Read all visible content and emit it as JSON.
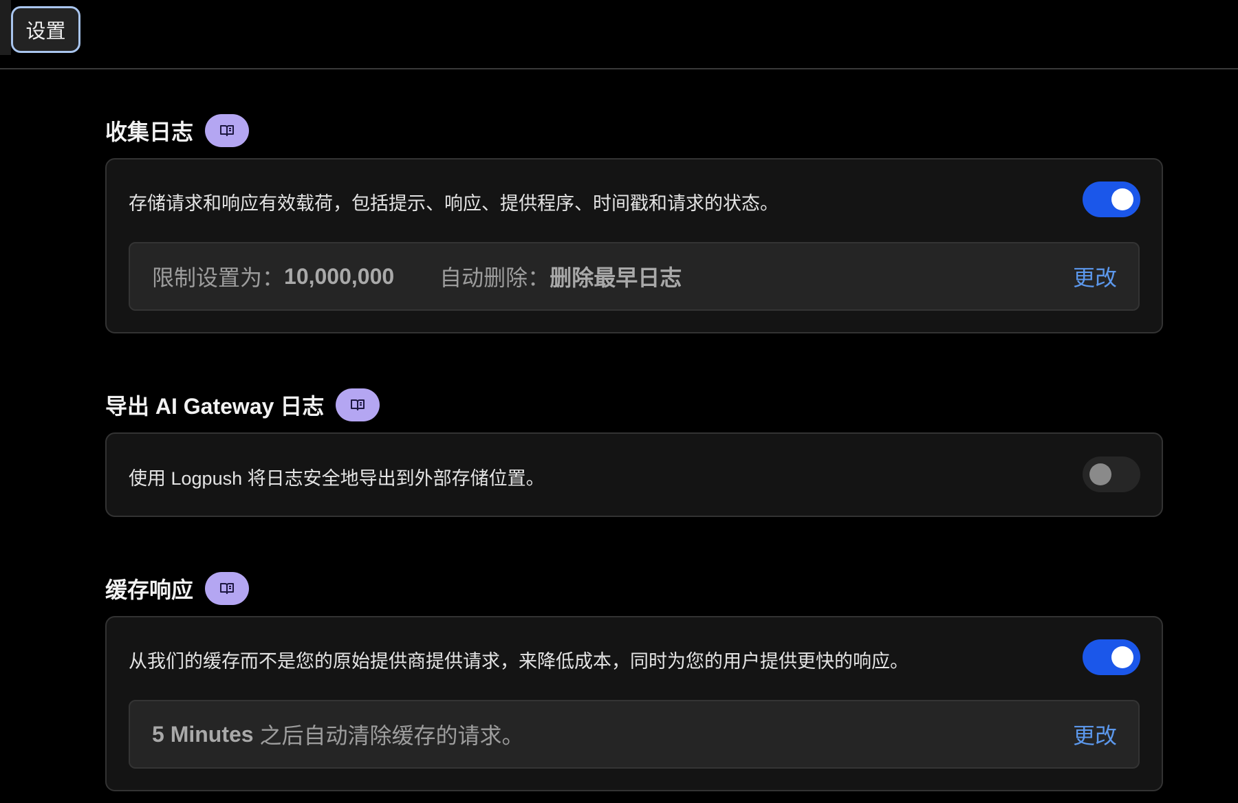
{
  "tabs": [
    {
      "label": "设置"
    }
  ],
  "sections": {
    "collect_logs": {
      "title": "收集日志",
      "description": "存储请求和响应有效载荷，包括提示、响应、提供程序、时间戳和请求的状态。",
      "enabled": true,
      "limit_label": "限制设置为：",
      "limit_value": "10,000,000",
      "auto_delete_label": "自动删除：",
      "auto_delete_value": "删除最早日志",
      "change_label": "更改"
    },
    "export_logs": {
      "title": "导出 AI Gateway 日志",
      "description": "使用 Logpush 将日志安全地导出到外部存储位置。",
      "enabled": false
    },
    "cache_responses": {
      "title": "缓存响应",
      "description": "从我们的缓存而不是您的原始提供商提供请求，来降低成本，同时为您的用户提供更快的响应。",
      "enabled": true,
      "ttl_value": "5 Minutes",
      "ttl_suffix": " 之后自动清除缓存的请求。",
      "change_label": "更改"
    }
  },
  "icons": {
    "doc": "book-open-icon"
  },
  "colors": {
    "background": "#000000",
    "card": "#141414",
    "subpanel": "#252525",
    "toggle_on": "#1b57ea",
    "toggle_off": "#262626",
    "badge": "#b4a6f2",
    "link": "#5c98ec",
    "tab_border": "#a9c5ee"
  }
}
